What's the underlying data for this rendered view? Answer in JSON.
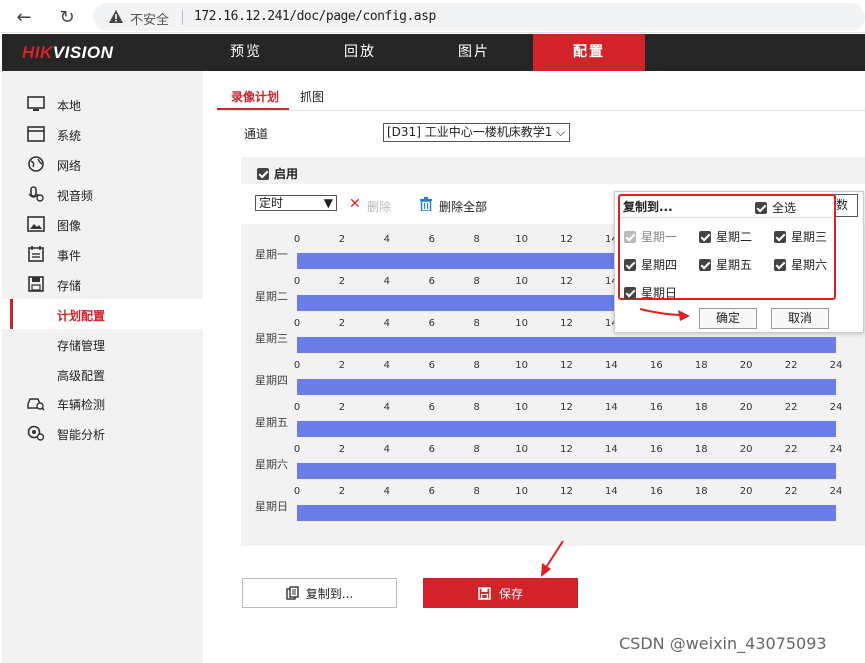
{
  "browser": {
    "insecure_label": "不安全",
    "url": "172.16.12.241/doc/page/config.asp"
  },
  "brand": {
    "logo_hk": "HIK",
    "logo_rest": "VISION"
  },
  "topnav": [
    {
      "label": "预览",
      "active": false
    },
    {
      "label": "回放",
      "active": false
    },
    {
      "label": "图片",
      "active": false
    },
    {
      "label": "配置",
      "active": true
    }
  ],
  "sidebar": [
    {
      "label": "本地",
      "icon": "monitor-icon"
    },
    {
      "label": "系统",
      "icon": "window-icon"
    },
    {
      "label": "网络",
      "icon": "globe-icon"
    },
    {
      "label": "视音频",
      "icon": "microphone-icon"
    },
    {
      "label": "图像",
      "icon": "image-icon"
    },
    {
      "label": "事件",
      "icon": "calendar-icon"
    },
    {
      "label": "存储",
      "icon": "save-icon"
    },
    {
      "label": "计划配置",
      "icon": "",
      "active": true
    },
    {
      "label": "存储管理",
      "icon": ""
    },
    {
      "label": "高级配置",
      "icon": ""
    },
    {
      "label": "车辆检测",
      "icon": "car-search-icon"
    },
    {
      "label": "智能分析",
      "icon": "smart-analysis-icon"
    }
  ],
  "tabs": {
    "record": "录像计划",
    "capture": "抓图"
  },
  "channel": {
    "label": "通道",
    "value": "[D31] 工业中心一楼机床教学1"
  },
  "enable": {
    "label": "启用",
    "checked": true
  },
  "toolbar": {
    "type_value": "定时",
    "delete_label": "删除",
    "delete_all_label": "删除全部"
  },
  "schedule": {
    "ticks": [
      "0",
      "2",
      "4",
      "6",
      "8",
      "10",
      "12",
      "14",
      "16",
      "18",
      "20",
      "22",
      "24"
    ],
    "days": [
      "星期一",
      "星期二",
      "星期三",
      "星期四",
      "星期五",
      "星期六",
      "星期日"
    ],
    "bar_color": "#6b7de6"
  },
  "buttons": {
    "copy_to": "复制到...",
    "save": "保存"
  },
  "popup": {
    "title": "复制到...",
    "select_all": "全选",
    "days": [
      {
        "label": "星期一",
        "checked": true,
        "disabled": true
      },
      {
        "label": "星期二",
        "checked": true,
        "disabled": false
      },
      {
        "label": "星期三",
        "checked": true,
        "disabled": false
      },
      {
        "label": "星期四",
        "checked": true,
        "disabled": false
      },
      {
        "label": "星期五",
        "checked": true,
        "disabled": false
      },
      {
        "label": "星期六",
        "checked": true,
        "disabled": false
      },
      {
        "label": "星期日",
        "checked": true,
        "disabled": false
      }
    ],
    "ok": "确定",
    "cancel": "取消",
    "behind_text": "数"
  },
  "watermark": "CSDN @weixin_43075093",
  "colors": {
    "brand_red": "#d2232a",
    "annotation_red": "#e02020",
    "bar_blue": "#6b7de6"
  }
}
